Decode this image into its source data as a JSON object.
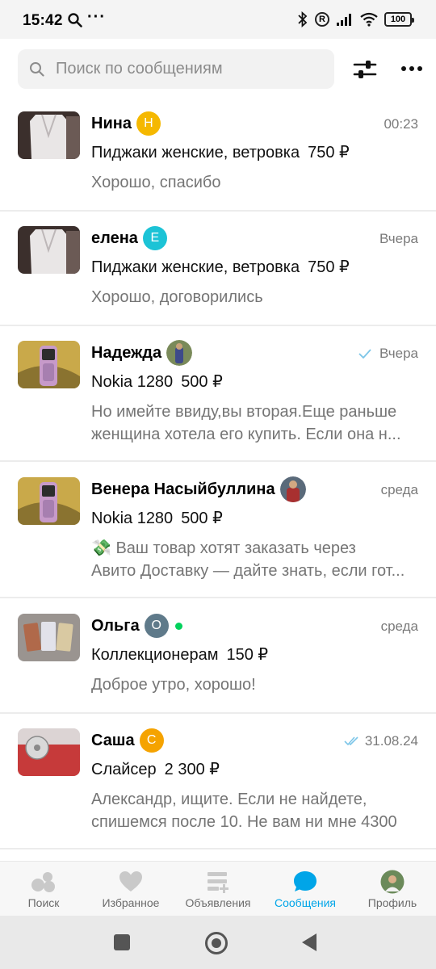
{
  "status_bar": {
    "time": "15:42",
    "dots": "···",
    "r_badge": "R",
    "battery": "100"
  },
  "search": {
    "placeholder": "Поиск по сообщениям",
    "search_icon": "search-icon",
    "filter_icon": "sliders-icon",
    "more_icon": "more-horizontal-icon"
  },
  "chats": [
    {
      "name": "Нина",
      "badge_letter": "Н",
      "badge_color": "#f5b800",
      "time": "00:23",
      "item": "Пиджаки женские, ветровка",
      "price": "750 ₽",
      "message_lines": [
        "Хорошо, спасибо"
      ]
    },
    {
      "name": "елена",
      "badge_letter": "Е",
      "badge_color": "#1cc3d6",
      "time": "Вчера",
      "item": "Пиджаки женские, ветровка",
      "price": "750 ₽",
      "message_lines": [
        "Хорошо, договорились"
      ]
    },
    {
      "name": "Надежда",
      "time": "Вчера",
      "read_status": "single-check",
      "item": "Nokia 1280",
      "price": "500 ₽",
      "message_lines": [
        "Но имейте ввиду,вы вторая.Еще раньше",
        "женщина хотела его купить. Если она н..."
      ]
    },
    {
      "name": "Венера Насыйбуллина",
      "time": "среда",
      "item": "Nokia 1280",
      "price": "500 ₽",
      "message_lines": [
        "💸 Ваш товар хотят заказать через",
        "Авито Доставку — дайте знать, если гот..."
      ]
    },
    {
      "name": "Ольга",
      "badge_letter": "О",
      "badge_color": "#5f7a8a",
      "online": true,
      "time": "среда",
      "item": "Коллекционерам",
      "price": "150 ₽",
      "message_lines": [
        "Доброе утро, хорошо!"
      ]
    },
    {
      "name": "Саша",
      "badge_letter": "С",
      "badge_color": "#f5a300",
      "time": "31.08.24",
      "read_status": "double-check",
      "item": "Слайсер",
      "price": "2 300 ₽",
      "message_lines": [
        "Александр, ищите. Если не найдете,",
        "спишемся после 10. Не вам ни мне 4300"
      ]
    }
  ],
  "bottom_nav": [
    {
      "label": "Поиск",
      "icon": "search-bubbles-icon",
      "active": false
    },
    {
      "label": "Избранное",
      "icon": "heart-icon",
      "active": false
    },
    {
      "label": "Объявления",
      "icon": "listings-add-icon",
      "active": false
    },
    {
      "label": "Сообщения",
      "icon": "chat-bubble-icon",
      "active": true
    },
    {
      "label": "Профиль",
      "icon": "profile-avatar-icon",
      "active": false
    }
  ],
  "colors": {
    "accent": "#00a5e8",
    "muted_text": "#757575",
    "online": "#02d15c"
  }
}
